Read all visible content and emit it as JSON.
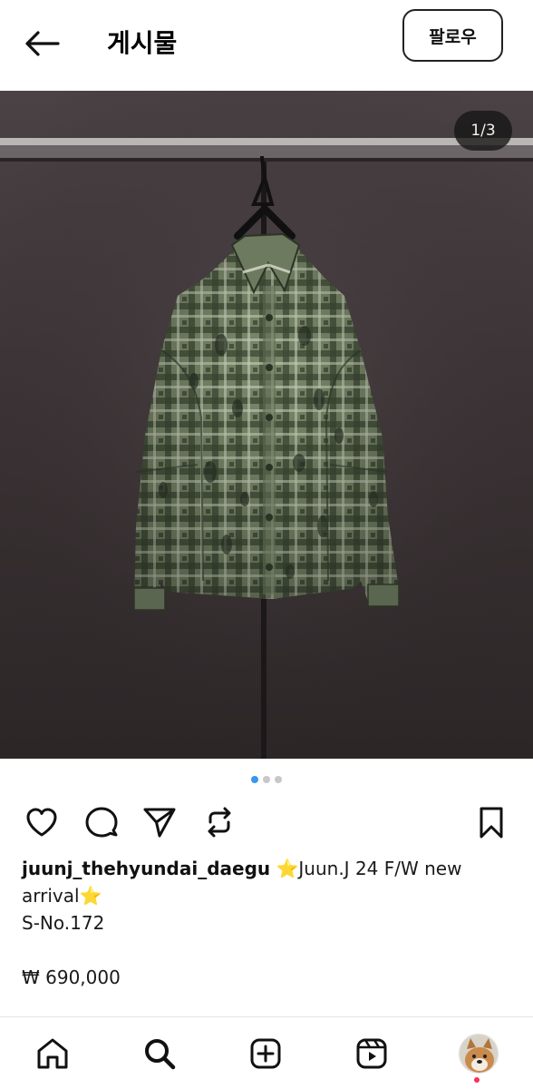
{
  "header": {
    "title": "게시물",
    "follow_label": "팔로우",
    "back_icon": "arrow-left-icon"
  },
  "post": {
    "image_description_icon": "shirt-photo",
    "counter": "1/3",
    "page_dots": {
      "count": 3,
      "active_index": 0
    },
    "dot_colors": {
      "active": "#3897f0",
      "inactive": "#c8c8c8"
    },
    "actions": {
      "like_icon": "heart-icon",
      "comment_icon": "comment-icon",
      "share_icon": "paper-plane-icon",
      "repost_icon": "repost-icon",
      "save_icon": "bookmark-icon"
    },
    "caption": {
      "username": "juunj_thehyundai_daegu",
      "text": " ⭐Juun.J 24 F/W new arrival⭐",
      "line2": "S-No.172"
    },
    "price": "₩ 690,000"
  },
  "bottom_nav": {
    "items": [
      "home-icon",
      "search-icon",
      "create-icon",
      "reels-icon",
      "profile-avatar"
    ],
    "notification_color": "#ff2d55"
  }
}
